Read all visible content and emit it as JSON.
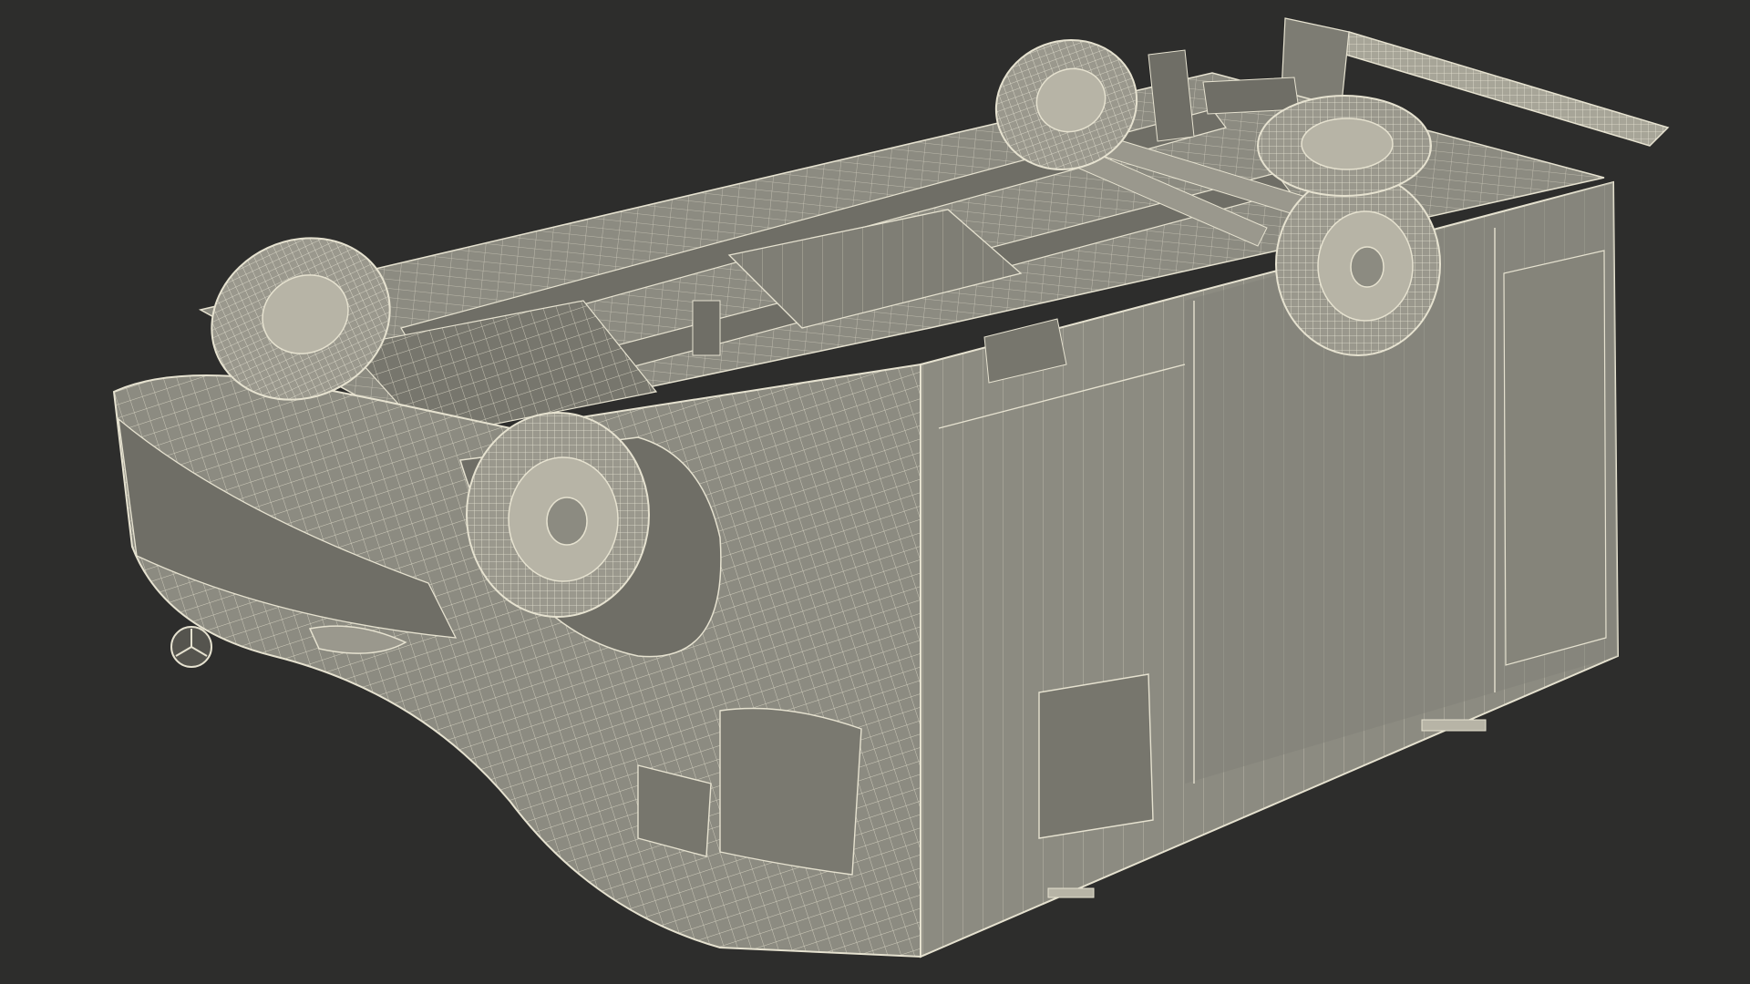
{
  "scene": {
    "subject": "van-wireframe-render",
    "orientation": "upside-down",
    "icon": "van-wireframe-icon"
  },
  "colors": {
    "background": "#2d2d2c",
    "body_fill": "#8c8b81",
    "body_shade": "#6f6e66",
    "body_dark": "#55544e",
    "wire": "#e6e2d0",
    "tire": "#9a988d",
    "rim": "#b7b4a6"
  }
}
